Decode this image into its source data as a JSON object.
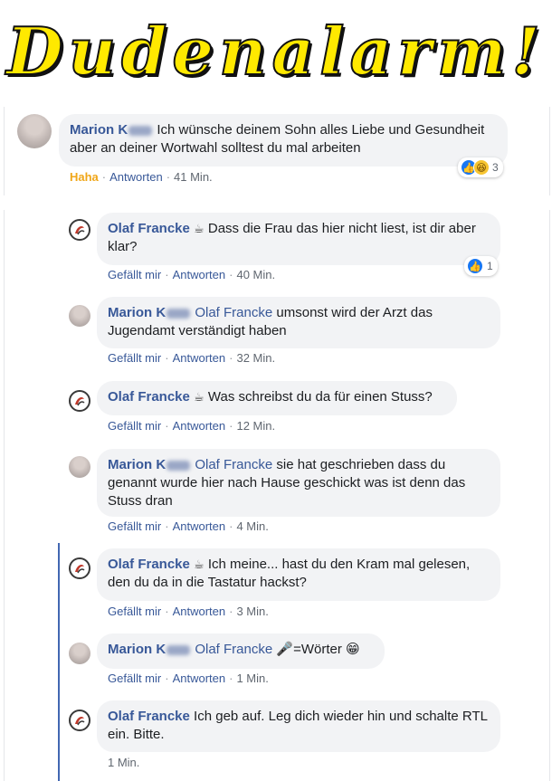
{
  "banner": {
    "title": "Dudenalarm!"
  },
  "comments": [
    {
      "author": "Marion K",
      "text": "Ich wünsche deinem Sohn alles Liebe und Gesundheit aber an deiner Wortwahl solltest du mal arbeiten",
      "reaction_label": "Haha",
      "reply_label": "Antworten",
      "time": "41 Min.",
      "reaction_count": "3"
    },
    {
      "author": "Olaf Francke",
      "text": "Dass die Frau das hier nicht liest, ist dir aber klar?",
      "like_label": "Gefällt mir",
      "reply_label": "Antworten",
      "time": "40 Min.",
      "reaction_count": "1"
    },
    {
      "author": "Marion K",
      "mention": "Olaf Francke",
      "text": "umsonst wird der Arzt das Jugendamt verständigt haben",
      "like_label": "Gefällt mir",
      "reply_label": "Antworten",
      "time": "32 Min."
    },
    {
      "author": "Olaf Francke",
      "text": "Was schreibst du da für einen Stuss?",
      "like_label": "Gefällt mir",
      "reply_label": "Antworten",
      "time": "12 Min."
    },
    {
      "author": "Marion K",
      "mention": "Olaf Francke",
      "text": "sie hat geschrieben dass du genannt wurde hier nach Hause geschickt was ist denn das Stuss dran",
      "like_label": "Gefällt mir",
      "reply_label": "Antworten",
      "time": "4 Min."
    },
    {
      "author": "Olaf Francke",
      "text": "Ich meine... hast du den Kram mal gelesen, den du da in die Tastatur hackst?",
      "like_label": "Gefällt mir",
      "reply_label": "Antworten",
      "time": "3 Min."
    },
    {
      "author": "Marion K",
      "mention": "Olaf Francke",
      "text": "=Wörter",
      "emoji_mic": "🎤",
      "emoji_grin": "😁",
      "like_label": "Gefällt mir",
      "reply_label": "Antworten",
      "time": "1 Min."
    },
    {
      "author": "Olaf Francke",
      "text": "Ich geb auf. Leg dich wieder hin und schalte RTL ein. Bitte.",
      "time": "1 Min."
    }
  ],
  "icons": {
    "cup": "☕",
    "like": "👍",
    "haha": "😆"
  },
  "colors": {
    "name": "#385898",
    "bubble": "#f2f3f5",
    "banner_fill": "#ffe900",
    "haha": "#f0a618"
  }
}
